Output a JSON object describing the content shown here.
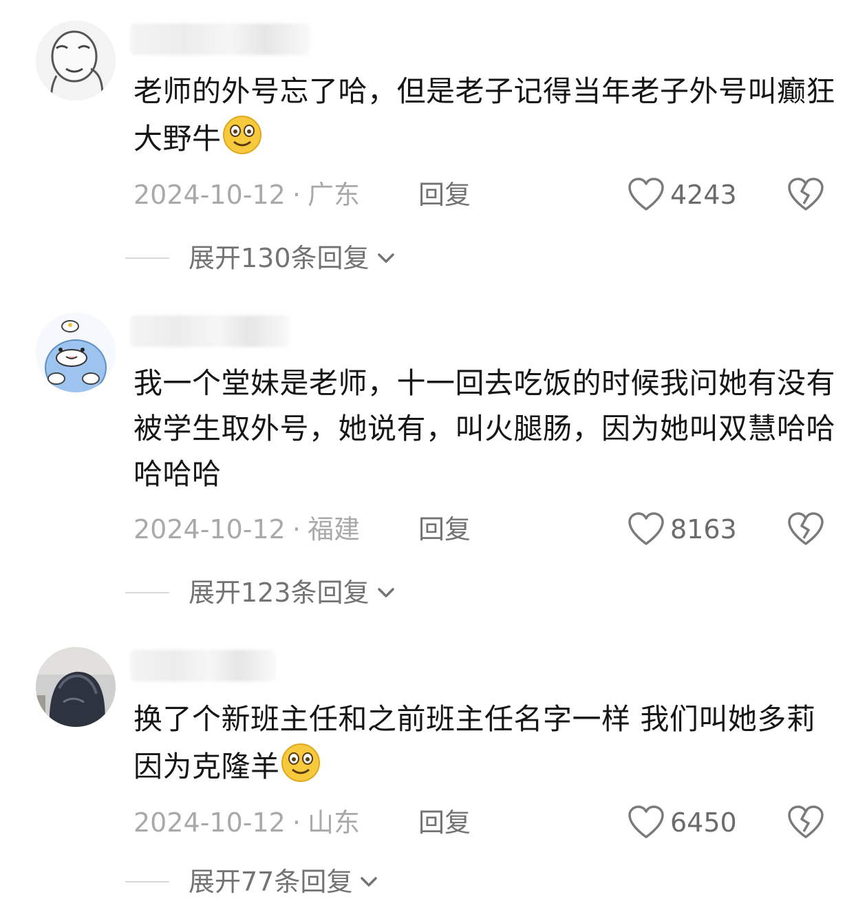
{
  "comments": [
    {
      "content": "老师的外号忘了哈，但是老子记得当年老子外号叫癫狂大野牛",
      "emoji": "smiling-face-emoji",
      "date": "2024-10-12",
      "location": "广东",
      "reply_label": "回复",
      "likes": "4243",
      "expand_label": "展开130条回复"
    },
    {
      "content": "我一个堂妹是老师，十一回去吃饭的时候我问她有没有被学生取外号，她说有，叫火腿肠，因为她叫双慧哈哈哈哈哈",
      "emoji": "",
      "date": "2024-10-12",
      "location": "福建",
      "reply_label": "回复",
      "likes": "8163",
      "expand_label": "展开123条回复"
    },
    {
      "content": "换了个新班主任和之前班主任名字一样 我们叫她多莉 因为克隆羊",
      "emoji": "smiling-face-emoji",
      "date": "2024-10-12",
      "location": "山东",
      "reply_label": "回复",
      "likes": "6450",
      "expand_label": "展开77条回复"
    }
  ],
  "separator": "·",
  "icons": {
    "like": "heart-outline-icon",
    "dislike": "broken-heart-icon",
    "expand": "chevron-down-icon"
  },
  "colors": {
    "text": "#161616",
    "meta": "#a9a9a9",
    "action": "#737373",
    "emoji": "#f7c93c"
  }
}
